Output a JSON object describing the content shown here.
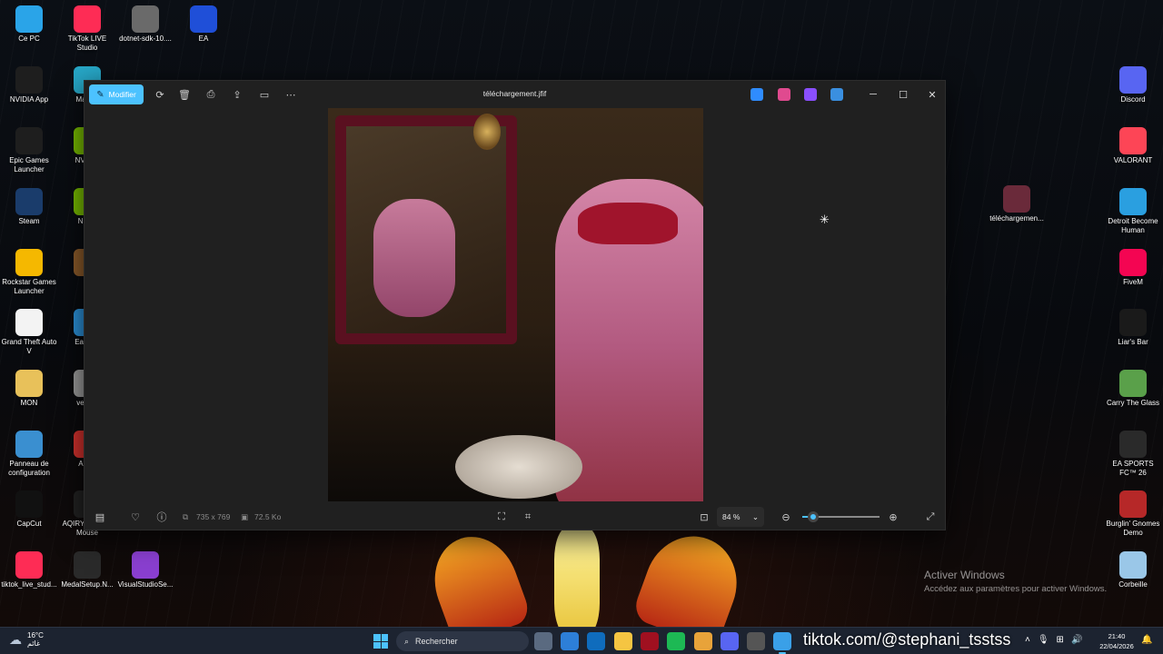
{
  "desktop": {
    "left_icons": [
      {
        "label": "Ce PC",
        "icon": "computer-icon",
        "color": "#2aa4e8"
      },
      {
        "label": "NVIDIA App",
        "icon": "nvidia-icon",
        "color": "#1e1e1e"
      },
      {
        "label": "Epic Games Launcher",
        "icon": "epic-games-icon",
        "color": "#1e1e1e"
      },
      {
        "label": "Steam",
        "icon": "steam-icon",
        "color": "#1a3c6b"
      },
      {
        "label": "Rockstar Games Launcher",
        "icon": "rockstar-icon",
        "color": "#f5b800"
      },
      {
        "label": "Grand Theft Auto V",
        "icon": "document-icon",
        "color": "#f3f3f3"
      },
      {
        "label": "MON",
        "icon": "folder-icon",
        "color": "#e8c15a"
      },
      {
        "label": "Panneau de configuration",
        "icon": "control-panel-icon",
        "color": "#3a8fd0"
      },
      {
        "label": "CapCut",
        "icon": "capcut-icon",
        "color": "#111111"
      },
      {
        "label": "tiktok_live_stud...",
        "icon": "tiktok-icon",
        "color": "#fe2c55"
      }
    ],
    "second_col_icons": [
      {
        "label": "TikTok LIVE Studio",
        "icon": "tiktok-live-icon",
        "color": "#fe2c55"
      },
      {
        "label": "Macro(",
        "icon": "macro-icon",
        "color": "#27a7c7"
      },
      {
        "label": "NVIDIA",
        "icon": "nvidia-icon",
        "color": "#76b900"
      },
      {
        "label": "N\nBro",
        "icon": "app-icon",
        "color": "#76b900"
      },
      {
        "label": "",
        "icon": "app-icon",
        "color": "#8a5a2a"
      },
      {
        "label": "EasyAn",
        "icon": "easyanticheat-icon",
        "color": "#2b8fd6"
      },
      {
        "label": "vectee",
        "icon": "app-icon",
        "color": "#9a9a9a"
      },
      {
        "label": "AnyD",
        "icon": "anydesk-icon",
        "color": "#d0312d"
      },
      {
        "label": "AQIRY Gaming Mouse",
        "icon": "mouse-icon",
        "color": "#222222"
      },
      {
        "label": "MedalSetup.N...",
        "icon": "medal-icon",
        "color": "#2a2a2a"
      }
    ],
    "top_icons": [
      {
        "label": "dotnet-sdk-10....",
        "icon": "installer-icon",
        "color": "#6a6a6a"
      },
      {
        "label": "EA",
        "icon": "ea-icon",
        "color": "#1f4fd8"
      },
      {
        "label": "VisualStudioSe...",
        "icon": "visual-studio-icon",
        "color": "#8a3fd0"
      }
    ],
    "right_icons": [
      {
        "label": "Discord",
        "icon": "discord-icon",
        "color": "#5865f2"
      },
      {
        "label": "VALORANT",
        "icon": "valorant-icon",
        "color": "#fd4556"
      },
      {
        "label": "Detroit Become Human",
        "icon": "detroit-icon",
        "color": "#2a9fe0"
      },
      {
        "label": "FiveM",
        "icon": "fivem-icon",
        "color": "#f40552"
      },
      {
        "label": "Liar's Bar",
        "icon": "liars-bar-icon",
        "color": "#1a1a1a"
      },
      {
        "label": "Carry The Glass",
        "icon": "carry-glass-icon",
        "color": "#5aa04a"
      },
      {
        "label": "EA SPORTS FC™ 26",
        "icon": "fc26-icon",
        "color": "#2a2a2a"
      },
      {
        "label": "Burglin' Gnomes Demo",
        "icon": "gnomes-icon",
        "color": "#b62828"
      },
      {
        "label": "Corbeille",
        "icon": "recycle-bin-icon",
        "color": "#9ac7e8"
      }
    ],
    "file_icon": {
      "label": "téléchargemen...",
      "icon": "image-file-icon"
    },
    "activation": {
      "title": "Activer Windows",
      "subtitle": "Accédez aux paramètres pour activer Windows."
    }
  },
  "viewer": {
    "title": "téléchargement.jfif",
    "edit_label": "Modifier",
    "toolbar_icons": [
      "rotate-icon",
      "delete-icon",
      "print-icon",
      "share-icon",
      "slideshow-icon",
      "more-icon"
    ],
    "app_icons": [
      {
        "name": "designer-icon",
        "color": "#2f8cff"
      },
      {
        "name": "clipchamp-icon",
        "color": "#e04a8f"
      },
      {
        "name": "ai-icon",
        "color": "#8a4fff"
      },
      {
        "name": "onedrive-icon",
        "color": "#3a8fe0"
      }
    ],
    "window_controls": {
      "minimize": "─",
      "maximize": "☐",
      "close": "✕"
    },
    "image_size": "735 x 769",
    "file_size": "72.5 Ko",
    "zoom": "84 %",
    "zoom_level": 0.14
  },
  "taskbar": {
    "weather_temp": "16°C",
    "weather_desc": "غائم",
    "search_placeholder": "Rechercher",
    "apps": [
      {
        "name": "task-view-icon",
        "color": "#5a6a80"
      },
      {
        "name": "store-icon",
        "color": "#2d7fd8"
      },
      {
        "name": "outlook-icon",
        "color": "#0f6cbd"
      },
      {
        "name": "explorer-icon",
        "color": "#f5c542"
      },
      {
        "name": "valorant-icon",
        "color": "#a01020"
      },
      {
        "name": "spotify-icon",
        "color": "#1db954"
      },
      {
        "name": "chrome-icon",
        "color": "#e8a33a"
      },
      {
        "name": "discord-icon",
        "color": "#5865f2"
      },
      {
        "name": "app-icon",
        "color": "#555555"
      },
      {
        "name": "photos-icon",
        "color": "#3aa0e8"
      }
    ],
    "watermark": "tiktok.com/@stephani_tsstss",
    "time": "21:40",
    "date": "22/04/2026"
  }
}
